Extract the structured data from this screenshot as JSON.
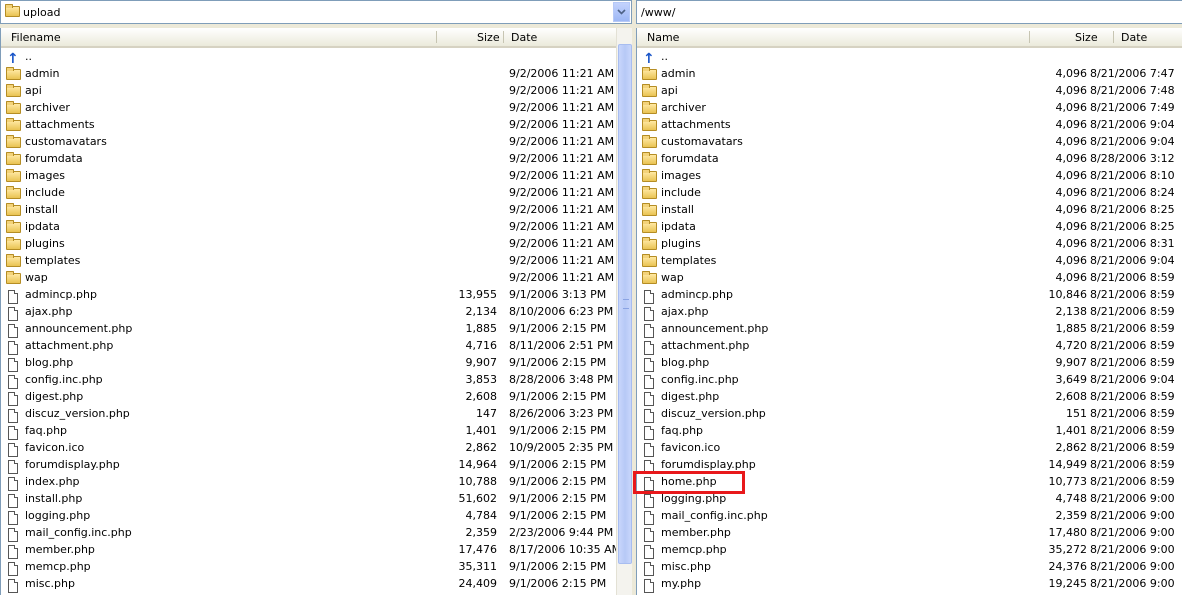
{
  "left": {
    "path": "upload",
    "columns": {
      "name": "Filename",
      "size": "Size",
      "date": "Date"
    },
    "up_label": "..",
    "rows": [
      {
        "type": "folder",
        "name": "admin",
        "size": "",
        "date": "9/2/2006 11:21 AM"
      },
      {
        "type": "folder",
        "name": "api",
        "size": "",
        "date": "9/2/2006 11:21 AM"
      },
      {
        "type": "folder",
        "name": "archiver",
        "size": "",
        "date": "9/2/2006 11:21 AM"
      },
      {
        "type": "folder",
        "name": "attachments",
        "size": "",
        "date": "9/2/2006 11:21 AM"
      },
      {
        "type": "folder",
        "name": "customavatars",
        "size": "",
        "date": "9/2/2006 11:21 AM"
      },
      {
        "type": "folder",
        "name": "forumdata",
        "size": "",
        "date": "9/2/2006 11:21 AM"
      },
      {
        "type": "folder",
        "name": "images",
        "size": "",
        "date": "9/2/2006 11:21 AM"
      },
      {
        "type": "folder",
        "name": "include",
        "size": "",
        "date": "9/2/2006 11:21 AM"
      },
      {
        "type": "folder",
        "name": "install",
        "size": "",
        "date": "9/2/2006 11:21 AM"
      },
      {
        "type": "folder",
        "name": "ipdata",
        "size": "",
        "date": "9/2/2006 11:21 AM"
      },
      {
        "type": "folder",
        "name": "plugins",
        "size": "",
        "date": "9/2/2006 11:21 AM"
      },
      {
        "type": "folder",
        "name": "templates",
        "size": "",
        "date": "9/2/2006 11:21 AM"
      },
      {
        "type": "folder",
        "name": "wap",
        "size": "",
        "date": "9/2/2006 11:21 AM"
      },
      {
        "type": "file",
        "name": "admincp.php",
        "size": "13,955",
        "date": "9/1/2006 3:13 PM"
      },
      {
        "type": "file",
        "name": "ajax.php",
        "size": "2,134",
        "date": "8/10/2006 6:23 PM"
      },
      {
        "type": "file",
        "name": "announcement.php",
        "size": "1,885",
        "date": "9/1/2006 2:15 PM"
      },
      {
        "type": "file",
        "name": "attachment.php",
        "size": "4,716",
        "date": "8/11/2006 2:51 PM"
      },
      {
        "type": "file",
        "name": "blog.php",
        "size": "9,907",
        "date": "9/1/2006 2:15 PM"
      },
      {
        "type": "file",
        "name": "config.inc.php",
        "size": "3,853",
        "date": "8/28/2006 3:48 PM"
      },
      {
        "type": "file",
        "name": "digest.php",
        "size": "2,608",
        "date": "9/1/2006 2:15 PM"
      },
      {
        "type": "file",
        "name": "discuz_version.php",
        "size": "147",
        "date": "8/26/2006 3:23 PM"
      },
      {
        "type": "file",
        "name": "faq.php",
        "size": "1,401",
        "date": "9/1/2006 2:15 PM"
      },
      {
        "type": "file",
        "name": "favicon.ico",
        "size": "2,862",
        "date": "10/9/2005 2:35 PM"
      },
      {
        "type": "file",
        "name": "forumdisplay.php",
        "size": "14,964",
        "date": "9/1/2006 2:15 PM"
      },
      {
        "type": "file",
        "name": "index.php",
        "size": "10,788",
        "date": "9/1/2006 2:15 PM"
      },
      {
        "type": "file",
        "name": "install.php",
        "size": "51,602",
        "date": "9/1/2006 2:15 PM"
      },
      {
        "type": "file",
        "name": "logging.php",
        "size": "4,784",
        "date": "9/1/2006 2:15 PM"
      },
      {
        "type": "file",
        "name": "mail_config.inc.php",
        "size": "2,359",
        "date": "2/23/2006 9:44 PM"
      },
      {
        "type": "file",
        "name": "member.php",
        "size": "17,476",
        "date": "8/17/2006 10:35 AM"
      },
      {
        "type": "file",
        "name": "memcp.php",
        "size": "35,311",
        "date": "9/1/2006 2:15 PM"
      },
      {
        "type": "file",
        "name": "misc.php",
        "size": "24,409",
        "date": "9/1/2006 2:15 PM"
      }
    ]
  },
  "right": {
    "path": "/www/",
    "columns": {
      "name": "Name",
      "size": "Size",
      "date": "Date"
    },
    "up_label": "..",
    "rows": [
      {
        "type": "folder",
        "name": "admin",
        "size": "4,096",
        "date": "8/21/2006 7:47"
      },
      {
        "type": "folder",
        "name": "api",
        "size": "4,096",
        "date": "8/21/2006 7:48"
      },
      {
        "type": "folder",
        "name": "archiver",
        "size": "4,096",
        "date": "8/21/2006 7:49"
      },
      {
        "type": "folder",
        "name": "attachments",
        "size": "4,096",
        "date": "8/21/2006 9:04"
      },
      {
        "type": "folder",
        "name": "customavatars",
        "size": "4,096",
        "date": "8/21/2006 9:04"
      },
      {
        "type": "folder",
        "name": "forumdata",
        "size": "4,096",
        "date": "8/28/2006 3:12"
      },
      {
        "type": "folder",
        "name": "images",
        "size": "4,096",
        "date": "8/21/2006 8:10"
      },
      {
        "type": "folder",
        "name": "include",
        "size": "4,096",
        "date": "8/21/2006 8:24"
      },
      {
        "type": "folder",
        "name": "install",
        "size": "4,096",
        "date": "8/21/2006 8:25"
      },
      {
        "type": "folder",
        "name": "ipdata",
        "size": "4,096",
        "date": "8/21/2006 8:25"
      },
      {
        "type": "folder",
        "name": "plugins",
        "size": "4,096",
        "date": "8/21/2006 8:31"
      },
      {
        "type": "folder",
        "name": "templates",
        "size": "4,096",
        "date": "8/21/2006 9:04"
      },
      {
        "type": "folder",
        "name": "wap",
        "size": "4,096",
        "date": "8/21/2006 8:59"
      },
      {
        "type": "file",
        "name": "admincp.php",
        "size": "10,846",
        "date": "8/21/2006 8:59"
      },
      {
        "type": "file",
        "name": "ajax.php",
        "size": "2,138",
        "date": "8/21/2006 8:59"
      },
      {
        "type": "file",
        "name": "announcement.php",
        "size": "1,885",
        "date": "8/21/2006 8:59"
      },
      {
        "type": "file",
        "name": "attachment.php",
        "size": "4,720",
        "date": "8/21/2006 8:59"
      },
      {
        "type": "file",
        "name": "blog.php",
        "size": "9,907",
        "date": "8/21/2006 8:59"
      },
      {
        "type": "file",
        "name": "config.inc.php",
        "size": "3,649",
        "date": "8/21/2006 9:04"
      },
      {
        "type": "file",
        "name": "digest.php",
        "size": "2,608",
        "date": "8/21/2006 8:59"
      },
      {
        "type": "file",
        "name": "discuz_version.php",
        "size": "151",
        "date": "8/21/2006 8:59"
      },
      {
        "type": "file",
        "name": "faq.php",
        "size": "1,401",
        "date": "8/21/2006 8:59"
      },
      {
        "type": "file",
        "name": "favicon.ico",
        "size": "2,862",
        "date": "8/21/2006 8:59"
      },
      {
        "type": "file",
        "name": "forumdisplay.php",
        "size": "14,949",
        "date": "8/21/2006 8:59"
      },
      {
        "type": "file",
        "name": "home.php",
        "size": "10,773",
        "date": "8/21/2006 8:59"
      },
      {
        "type": "file",
        "name": "logging.php",
        "size": "4,748",
        "date": "8/21/2006 9:00"
      },
      {
        "type": "file",
        "name": "mail_config.inc.php",
        "size": "2,359",
        "date": "8/21/2006 9:00"
      },
      {
        "type": "file",
        "name": "member.php",
        "size": "17,480",
        "date": "8/21/2006 9:00"
      },
      {
        "type": "file",
        "name": "memcp.php",
        "size": "35,272",
        "date": "8/21/2006 9:00"
      },
      {
        "type": "file",
        "name": "misc.php",
        "size": "24,376",
        "date": "8/21/2006 9:00"
      },
      {
        "type": "file",
        "name": "my.php",
        "size": "19,245",
        "date": "8/21/2006 9:00"
      }
    ]
  },
  "colors": {
    "highlight": "#e8181b",
    "border": "#7f9db9"
  }
}
